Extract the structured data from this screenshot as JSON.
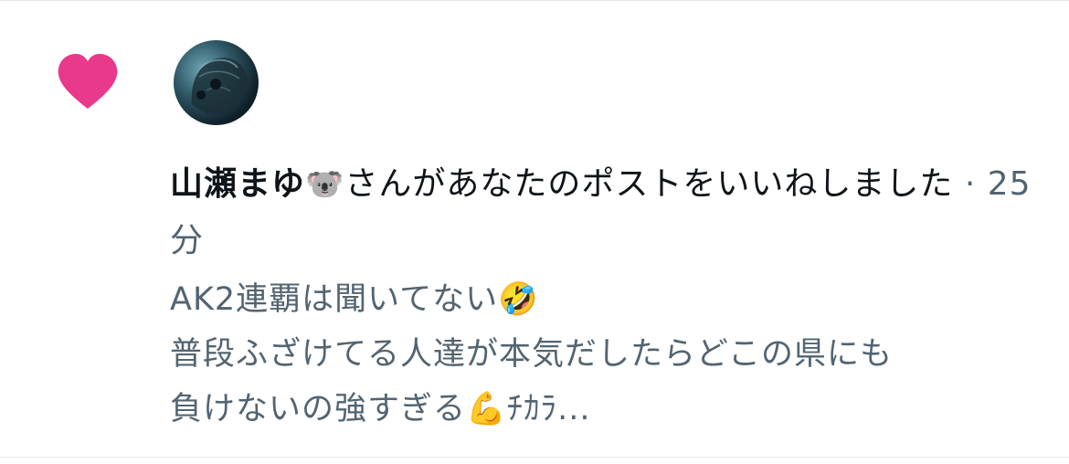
{
  "notification": {
    "type_icon": "heart-icon",
    "heart_color": "#e9398c",
    "avatar_icon": "avatar",
    "username": "山瀬まゆ",
    "username_emoji": "🐨",
    "action_text": "さんがあなたのポストをいいねしました",
    "separator": "·",
    "timestamp": "25分",
    "post_lines": [
      "AK2連覇は聞いてない🤣",
      "普段ふざけてる人達が本気だしたらどこの県にも",
      "負けないの強すぎる💪ﾁｶﾗ..."
    ]
  }
}
